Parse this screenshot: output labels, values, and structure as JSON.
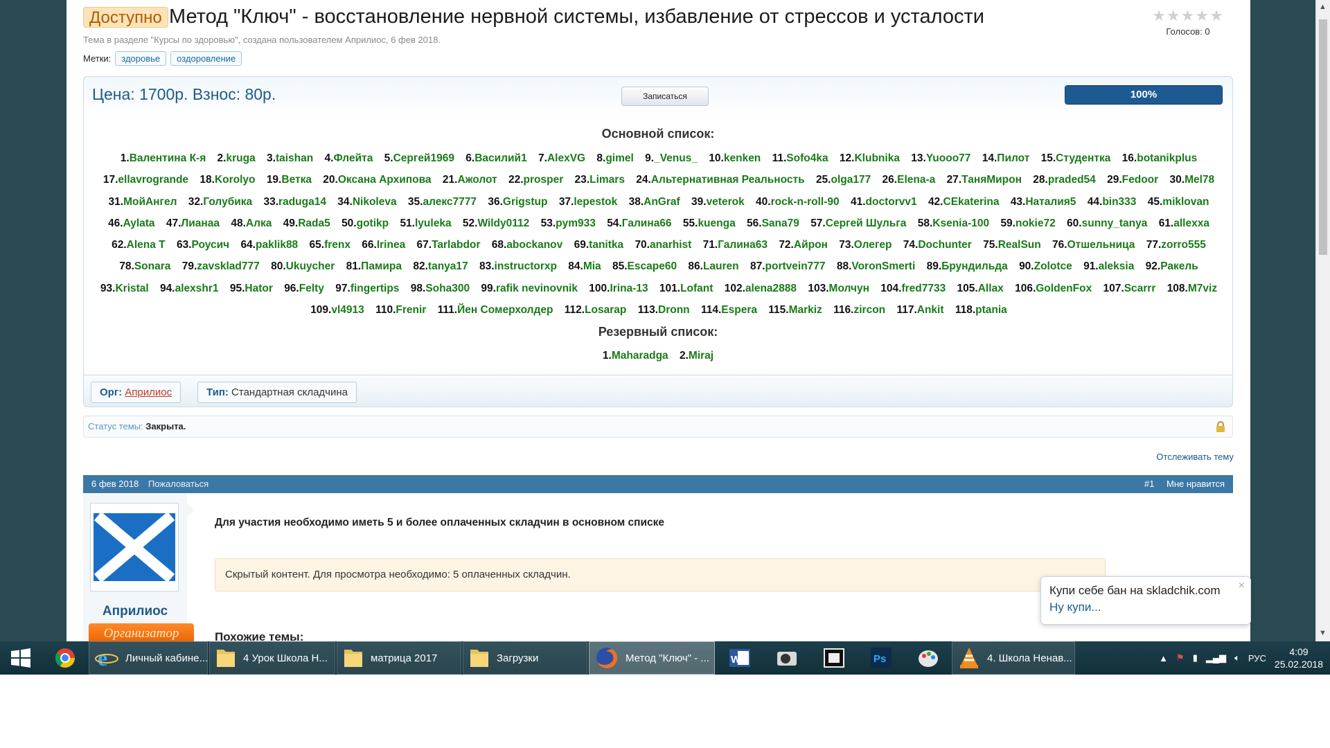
{
  "thread": {
    "prefix": "Доступно",
    "title": "Метод \"Ключ\" - восстановление нервной системы, избавление от стрессов и усталости",
    "meta": "Тема в разделе \"Курсы по здоровью\", создана пользователем Априлиос, 6 фев 2018.",
    "stars": "★★★★★",
    "votes": "Голосов: 0",
    "tags_label": "Метки:",
    "tags": [
      "здоровье",
      "оздоровление"
    ]
  },
  "skladchina": {
    "price": "Цена: 1700р.  Взнос: 80р.",
    "join_label": "Записаться",
    "progress_label": "100%",
    "progress_percent": 100,
    "main_heading": "Основной список:",
    "reserve_heading": "Резервный список:",
    "members": [
      "Валентина К-я",
      "kruga",
      "taishan",
      "Флейта",
      "Сергей1969",
      "Василий1",
      "AlexVG",
      "gimel",
      "_Venus_",
      "kenken",
      "Sofo4ka",
      "Klubnika",
      "Yuooo77",
      "Пилот",
      "Студентка",
      "botanikplus",
      "ellavrogrande",
      "Korolyo",
      "Ветка",
      "Оксана Архипова",
      "Ажолот",
      "prosper",
      "Limars",
      "Альтернативная Реальность",
      "olga177",
      "Elena-a",
      "ТаняМирон",
      "praded54",
      "Fedoor",
      "Mel78",
      "МойАнгел",
      "Голубика",
      "raduga14",
      "Nikoleva",
      "алекс7777",
      "Grigstup",
      "lepestok",
      "AnGraf",
      "veterok",
      "rock-n-roll-90",
      "doctorvv1",
      "CEkaterina",
      "Наталия5",
      "bin333",
      "miklovan",
      "Aylata",
      "Лианаа",
      "Алка",
      "Rada5",
      "gotikp",
      "lyuleka",
      "Wildy0112",
      "pym933",
      "Галина66",
      "kuenga",
      "Sana79",
      "Сергей Шульга",
      "Ksenia-100",
      "nokie72",
      "sunny_tanya",
      "allexxa",
      "Alena T",
      "Роусич",
      "paklik88",
      "frenx",
      "Irinea",
      "Tarlabdor",
      "abockanov",
      "tanitka",
      "anarhist",
      "Галина63",
      "Айрон",
      "Олегер",
      "Dochunter",
      "RealSun",
      "Отшельница",
      "zorro555",
      "Sonara",
      "zavsklad777",
      "Ukuycher",
      "Памира",
      "tanya17",
      "instructorxp",
      "Mia",
      "Escape60",
      "Lauren",
      "portvein777",
      "VoronSmerti",
      "Брундильда",
      "Zolotce",
      "aleksia",
      "Ракель",
      "Kristal",
      "alexshr1",
      "Hator",
      "Felty",
      "fingertips",
      "Soha300",
      "rafik nevinovnik",
      "Irina-13",
      "Lofant",
      "alena2888",
      "Молчун",
      "fred7733",
      "Allax",
      "GoldenFox",
      "Scarrr",
      "M7viz",
      "vl4913",
      "Frenir",
      "Йен Сомерхолдер",
      "Losarap",
      "Dronn",
      "Espera",
      "Markiz",
      "zircon",
      "Ankit",
      "ptania"
    ],
    "reserve": [
      "Maharadga",
      "Miraj"
    ],
    "org_label": "Орг:",
    "org_name": "Априлиос",
    "type_label": "Тип:",
    "type_value": "Стандартная складчина"
  },
  "status": {
    "label": "Статус темы:",
    "value": "Закрыта."
  },
  "watch_label": "Отслеживать тему",
  "post": {
    "date": "6 фев 2018",
    "report": "Пожаловаться",
    "number": "#1",
    "like": "Мне нравится",
    "username": "Априлиос",
    "role": "Организатор",
    "body": "Для участия необходимо иметь 5 и более оплаченных складчин в основном списке",
    "hidden": "Скрытый контент. Для просмотра необходимо: 5 оплаченных складчин.",
    "similar": "Похожие темы:"
  },
  "toast": {
    "line1": "Купи себе бан на skladchik.com",
    "line2": "Ну купи...",
    "close": "×"
  },
  "taskbar": {
    "apps": [
      {
        "label": "Личный кабине...",
        "icon": "ie-icon"
      },
      {
        "label": "4 Урок Школа Н...",
        "icon": "folder-icon"
      },
      {
        "label": "матрица 2017",
        "icon": "folder-icon"
      },
      {
        "label": "Загрузки",
        "icon": "folder-icon"
      },
      {
        "label": "Метод \"Ключ\" - ...",
        "icon": "firefox-icon"
      },
      {
        "label": "4. Школа Ненав...",
        "icon": "vlc-icon"
      }
    ],
    "lang": "РУС",
    "time": "4:09",
    "date": "25.02.2018"
  },
  "colors": {
    "accent": "#3b78a6",
    "member_name": "#1a7a1a",
    "progress": "#1e5a92",
    "badge": "#ea6100"
  }
}
